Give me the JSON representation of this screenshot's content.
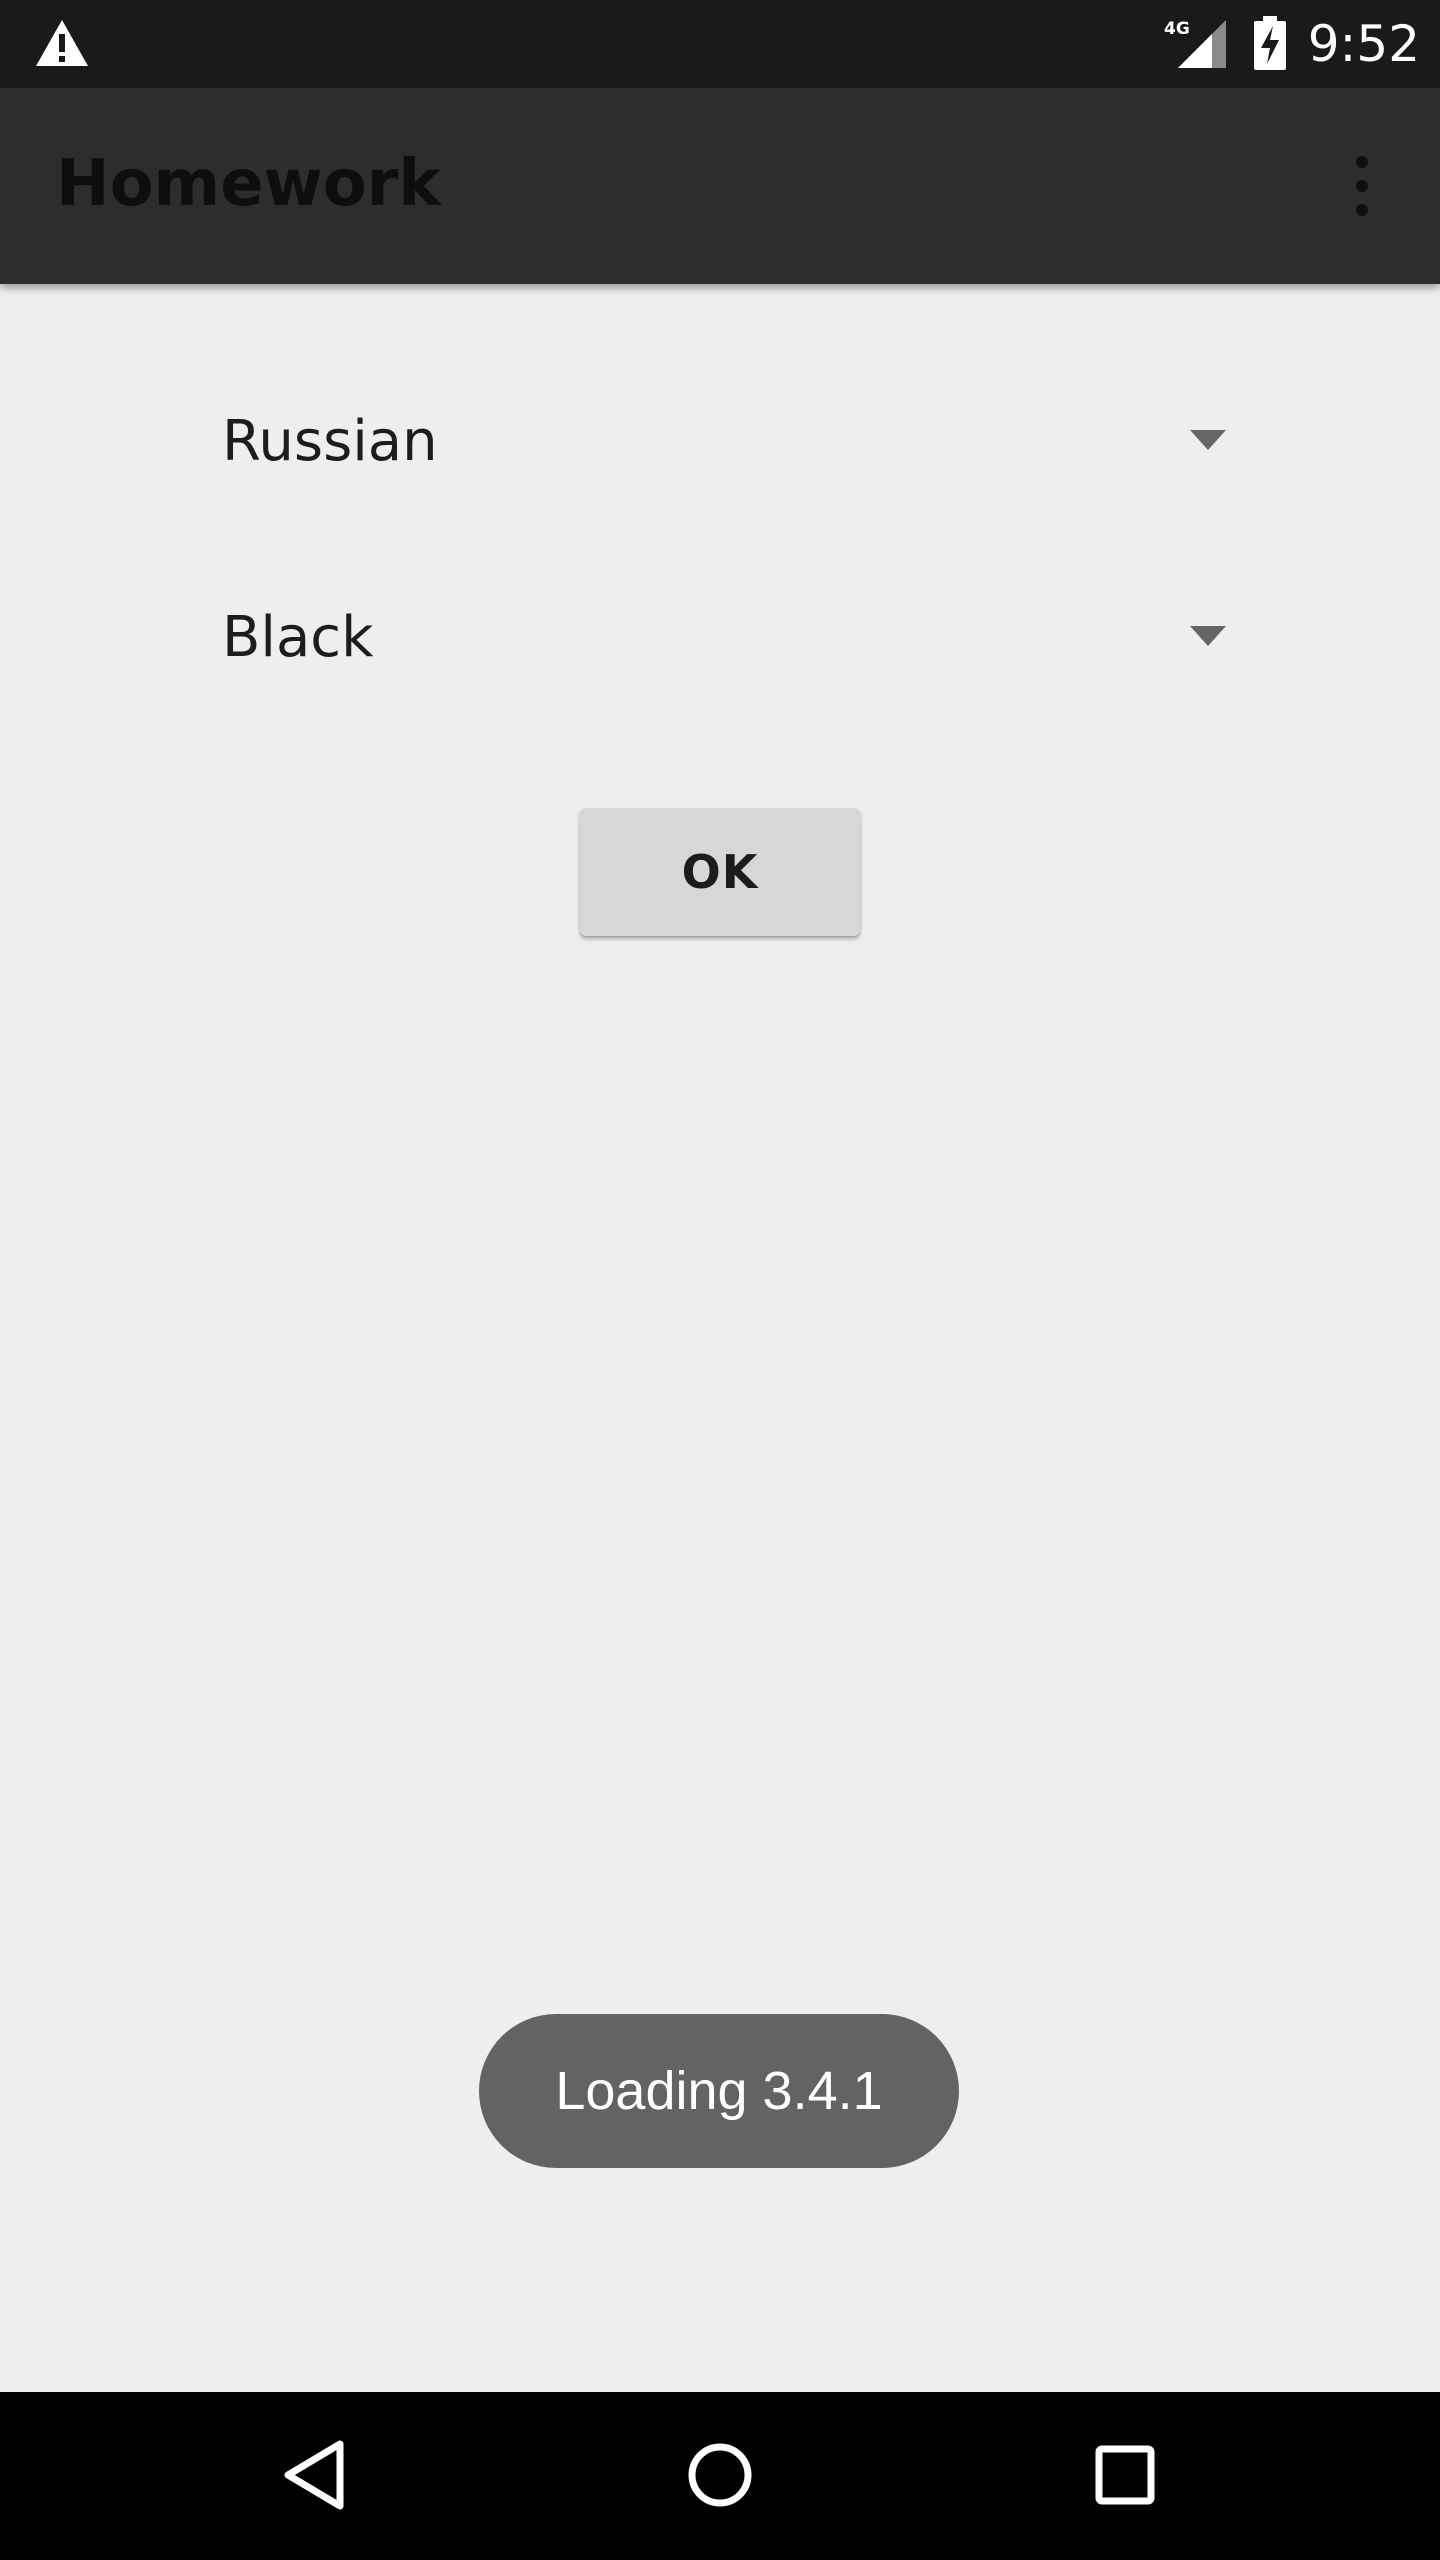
{
  "status_bar": {
    "icons": [
      "warning-icon",
      "signal-4g-icon",
      "battery-charging-icon"
    ],
    "network_label": "4G",
    "time": "9:52"
  },
  "app_bar": {
    "title": "Homework",
    "overflow_icon": "more-vert-icon"
  },
  "form": {
    "language_spinner": {
      "selected": "Russian",
      "icon": "dropdown-arrow-icon"
    },
    "color_spinner": {
      "selected": "Black",
      "icon": "dropdown-arrow-icon"
    },
    "ok_button": "OK"
  },
  "toast": {
    "message": "Loading 3.4.1"
  },
  "nav_bar": {
    "buttons": [
      "back-icon",
      "home-icon",
      "recents-icon"
    ]
  },
  "colors": {
    "status_bar": "#1a1a1a",
    "app_bar": "#2d2d2d",
    "background": "#eeeeee",
    "button": "#d7d7d7",
    "toast": "#636363",
    "nav_bar": "#000000"
  }
}
